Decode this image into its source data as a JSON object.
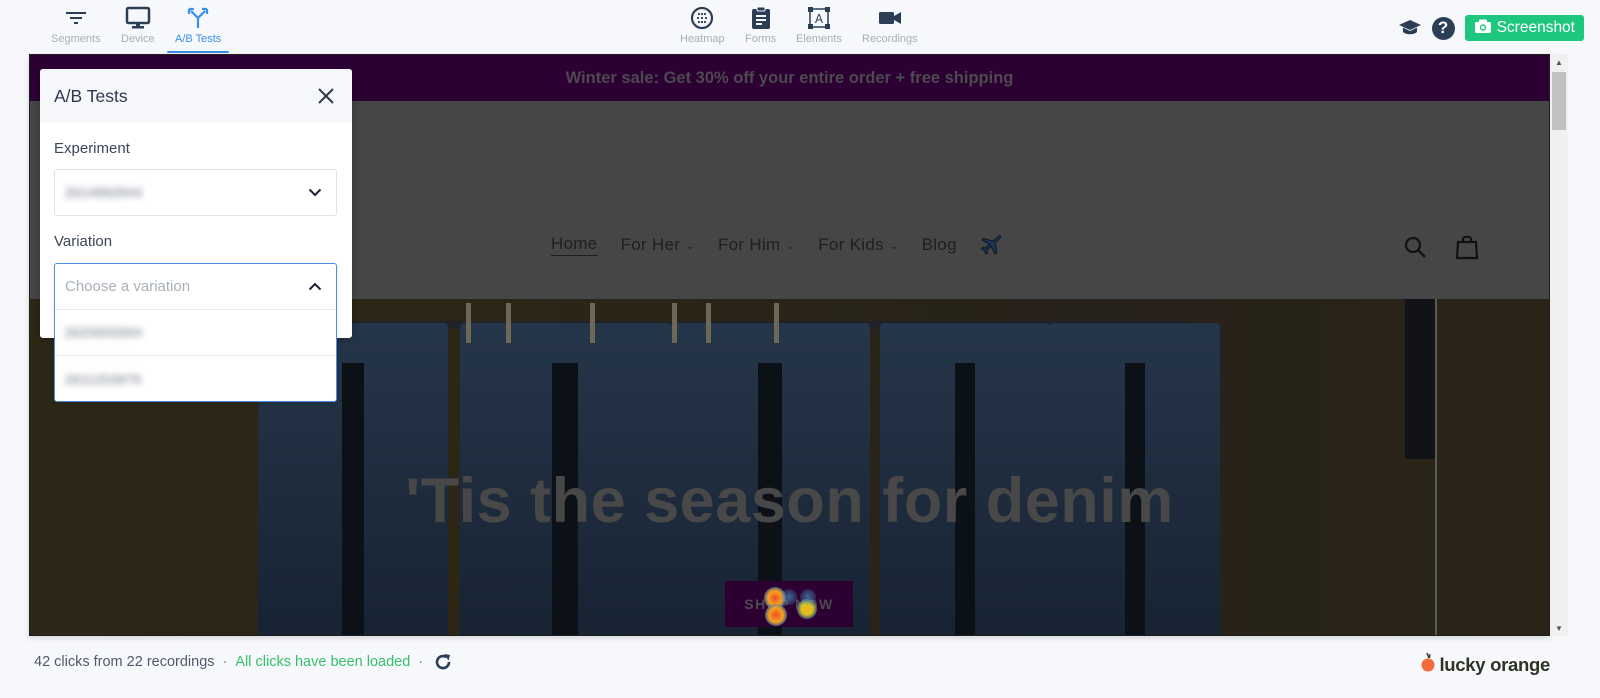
{
  "toolbar": {
    "left_tools": [
      {
        "label": "Segments",
        "icon": "filter-icon",
        "active": false
      },
      {
        "label": "Device",
        "icon": "monitor-icon",
        "active": false
      },
      {
        "label": "A/B Tests",
        "icon": "split-arrows-icon",
        "active": true
      }
    ],
    "center_tools": [
      {
        "label": "Heatmap",
        "icon": "heatmap-dots-icon"
      },
      {
        "label": "Forms",
        "icon": "clipboard-icon"
      },
      {
        "label": "Elements",
        "icon": "element-select-icon"
      },
      {
        "label": "Recordings",
        "icon": "video-camera-icon"
      }
    ],
    "academy_icon": "graduation-cap-icon",
    "help_icon": "question-circle-icon",
    "help_glyph": "?",
    "screenshot_label": "Screenshot",
    "accent_color": "#3a8fe8",
    "screenshot_color": "#1ec77e"
  },
  "ab_panel": {
    "title": "A/B Tests",
    "experiment_label": "Experiment",
    "experiment_value": "2614992844",
    "variation_label": "Variation",
    "variation_placeholder": "Choose a variation",
    "variation_options": [
      "2625650004",
      "2611253979"
    ]
  },
  "website": {
    "banner_text": "Winter sale: Get 30% off your entire order + free shipping",
    "nav": [
      {
        "label": "Home",
        "dropdown": false
      },
      {
        "label": "For Her",
        "dropdown": true
      },
      {
        "label": "For Him",
        "dropdown": true
      },
      {
        "label": "For Kids",
        "dropdown": true
      },
      {
        "label": "Blog",
        "dropdown": false
      }
    ],
    "nav_chevron": "⌄",
    "hero_title": "'Tis the season for denim",
    "cta_label": "SHOP NOW",
    "brand_color": "#2d0034"
  },
  "scrollbar": {
    "up_glyph": "▲",
    "down_glyph": "▼"
  },
  "status": {
    "clicks_text": "42 clicks from 22 recordings",
    "separator": "·",
    "loaded_text": "All clicks have been loaded"
  },
  "brand": {
    "name": "lucky orange",
    "logo_color": "#f26b3a"
  }
}
